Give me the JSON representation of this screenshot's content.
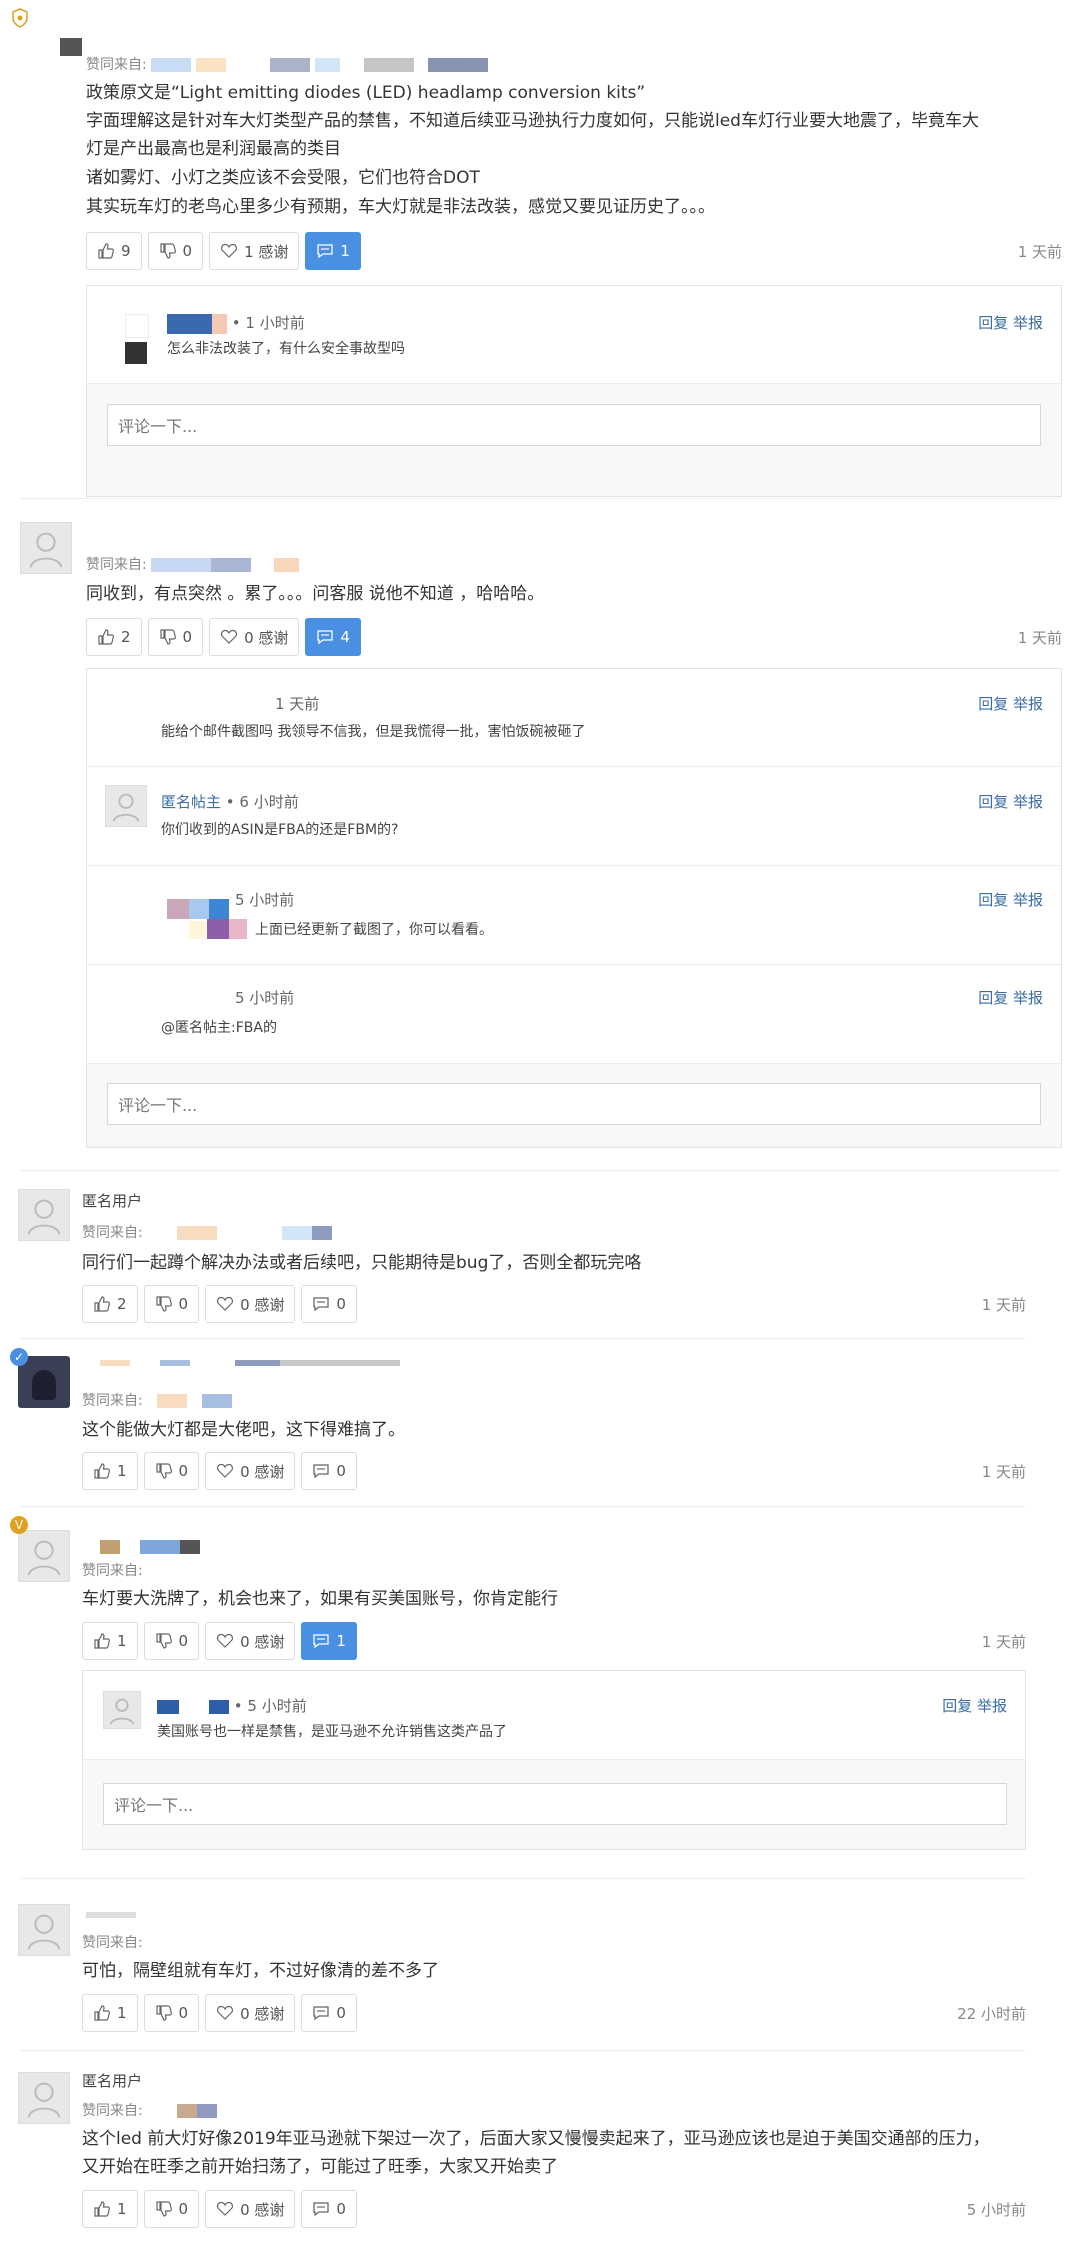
{
  "comments": [
    {
      "via_label": "赞同来自:",
      "lines": [
        "政策原文是“Light emitting diodes (LED) headlamp conversion kits”",
        "字面理解这是针对车大灯类型产品的禁售，不知道后续亚马逊执行力度如何，只能说led车灯行业要大地震了，毕竟车大",
        "灯是产出最高也是利润最高的类目",
        "诸如雾灯、小灯之类应该不会受限，它们也符合DOT",
        "其实玩车灯的老鸟心里多少有预期，车大灯就是非法改装，感觉又要见证历史了。。。"
      ],
      "likes": "9",
      "dislikes": "0",
      "thanks": "1 感谢",
      "replies": "1",
      "time": "1 天前",
      "reply_list": [
        {
          "meta": "• 1 小时前",
          "text": "怎么非法改装了，有什么安全事故型吗"
        }
      ]
    },
    {
      "via_label": "赞同来自:",
      "lines": [
        "同收到，有点突然 。累了。。。问客服 说他不知道 ，哈哈哈。"
      ],
      "likes": "2",
      "dislikes": "0",
      "thanks": "0 感谢",
      "replies": "4",
      "time": "1 天前",
      "reply_list": [
        {
          "meta": "1 天前",
          "text": "能给个邮件截图吗 我领导不信我，但是我慌得一批，害怕饭碗被砸了"
        },
        {
          "name": "匿名帖主",
          "meta": "• 6 小时前",
          "text": "你们收到的ASIN是FBA的还是FBM的?"
        },
        {
          "meta": "5 小时前",
          "text": "上面已经更新了截图了，你可以看看。"
        },
        {
          "meta": "5 小时前",
          "text": "@匿名帖主:FBA的"
        }
      ]
    },
    {
      "name": "匿名用户",
      "via_label": "赞同来自:",
      "lines": [
        "同行们一起蹲个解决办法或者后续吧，只能期待是bug了，否则全都玩完咯"
      ],
      "likes": "2",
      "dislikes": "0",
      "thanks": "0 感谢",
      "replies": "0",
      "time": "1 天前"
    },
    {
      "via_label": "赞同来自:",
      "lines": [
        "这个能做大灯都是大佬吧，这下得难搞了。"
      ],
      "likes": "1",
      "dislikes": "0",
      "thanks": "0 感谢",
      "replies": "0",
      "time": "1 天前"
    },
    {
      "via_label": "赞同来自:",
      "lines": [
        "车灯要大洗牌了，机会也来了，如果有买美国账号，你肯定能行"
      ],
      "likes": "1",
      "dislikes": "0",
      "thanks": "0 感谢",
      "replies": "1",
      "time": "1 天前",
      "reply_list": [
        {
          "meta": "• 5 小时前",
          "text": "美国账号也一样是禁售，是亚马逊不允许销售这类产品了"
        }
      ]
    },
    {
      "via_label": "赞同来自:",
      "lines": [
        "可怕，隔壁组就有车灯，不过好像清的差不多了"
      ],
      "likes": "1",
      "dislikes": "0",
      "thanks": "0 感谢",
      "replies": "0",
      "time": "22 小时前"
    },
    {
      "name": "匿名用户",
      "via_label": "赞同来自:",
      "lines": [
        "这个led 前大灯好像2019年亚马逊就下架过一次了，后面大家又慢慢卖起来了，亚马逊应该也是迫于美国交通部的压力，",
        "又开始在旺季之前开始扫荡了，可能过了旺季，大家又开始卖了"
      ],
      "likes": "1",
      "dislikes": "0",
      "thanks": "0 感谢",
      "replies": "0",
      "time": "5 小时前"
    }
  ],
  "reply_actions": {
    "reply": "回复",
    "report": "举报"
  },
  "comment_placeholder": "评论一下...",
  "reply_from_anon": "匿名帖主",
  "colors": {
    "accent": "#4a90e2",
    "link": "#3a6ea5",
    "badge_blue": "#4a90e2",
    "badge_gold": "#e0a020"
  }
}
